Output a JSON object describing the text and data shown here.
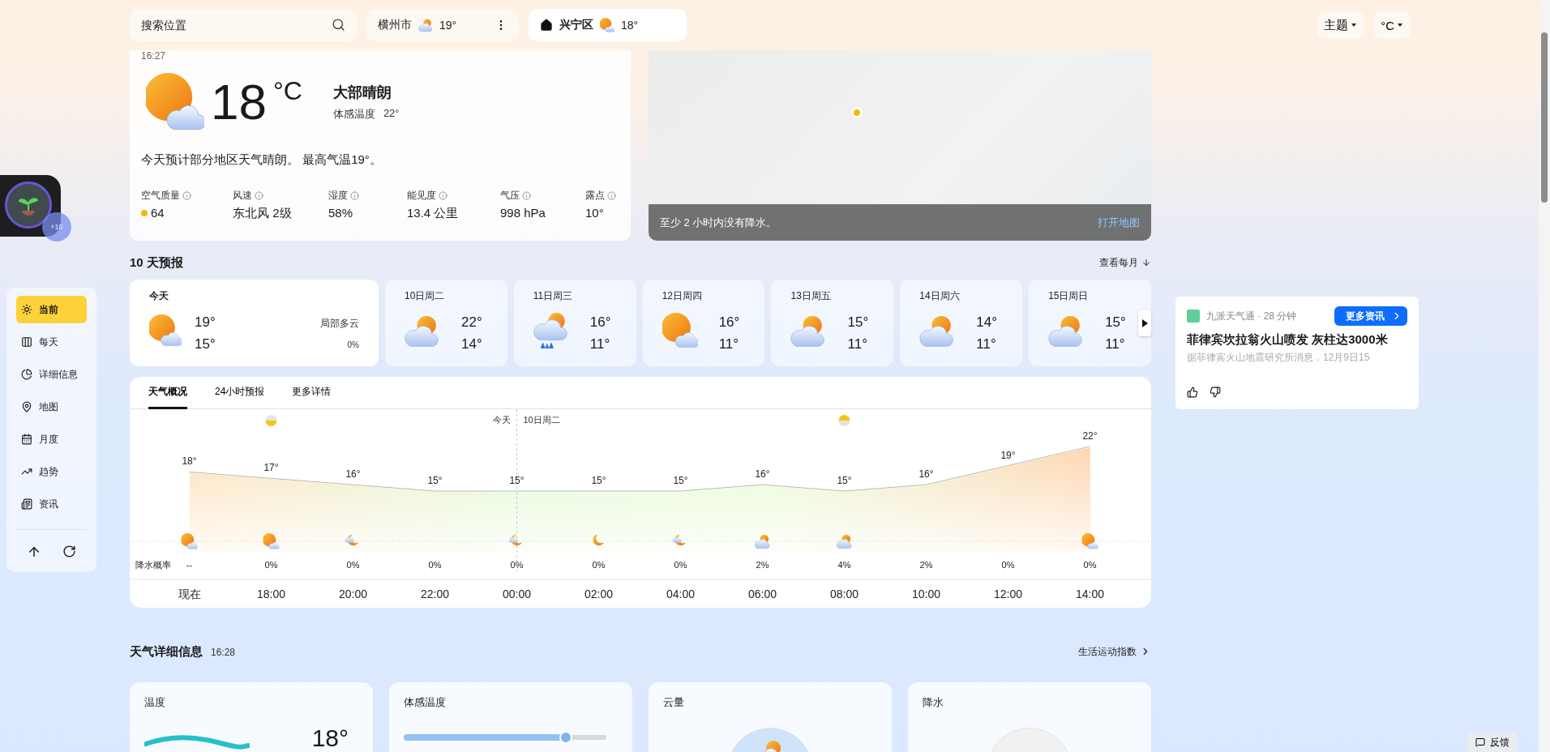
{
  "header": {
    "search": {
      "placeholder": "搜索位置"
    },
    "locations": [
      {
        "name": "横州市",
        "kind": "cloud-sun",
        "temp": "19°",
        "selected": false
      },
      {
        "name": "兴宁区",
        "kind": "sun-cloud",
        "temp": "18°",
        "selected": true
      }
    ],
    "menus": [
      "主题",
      "°C"
    ]
  },
  "widget": {
    "badge": "+10"
  },
  "sidebar": {
    "items": [
      {
        "label": "当前",
        "selected": true
      },
      {
        "label": "每天",
        "selected": false
      },
      {
        "label": "详细信息",
        "selected": false
      },
      {
        "label": "地图",
        "selected": false
      },
      {
        "label": "月度",
        "selected": false
      },
      {
        "label": "趋势",
        "selected": false
      },
      {
        "label": "资讯",
        "selected": false
      }
    ]
  },
  "current": {
    "time": "16:27",
    "temp": "18",
    "unit": "°C",
    "condition": "大部晴朗",
    "feels_label": "体感温度",
    "feels": "22°",
    "summary": "今天预计部分地区天气晴朗。 最高气温19°。",
    "metrics": [
      {
        "label": "空气质量",
        "value": "64",
        "color": "#f5b800"
      },
      {
        "label": "风速",
        "value": "东北风 2级"
      },
      {
        "label": "湿度",
        "value": "58%"
      },
      {
        "label": "能见度",
        "value": "13.4 公里"
      },
      {
        "label": "气压",
        "value": "998 hPa"
      },
      {
        "label": "露点",
        "value": "10°"
      }
    ]
  },
  "map": {
    "caption": "至少 2 小时内没有降水。",
    "link": "打开地图"
  },
  "forecast": {
    "title": "10 天预报",
    "link": "查看每月",
    "days": [
      {
        "date": "今天",
        "kind": "sun-cloud",
        "high": "19°",
        "low": "15°",
        "condition": "局部多云",
        "precip": "0%",
        "selected": true
      },
      {
        "date": "10日周二",
        "kind": "cloud-sun",
        "high": "22°",
        "low": "14°",
        "selected": false
      },
      {
        "date": "11日周三",
        "kind": "rain",
        "high": "16°",
        "low": "11°",
        "selected": false
      },
      {
        "date": "12日周四",
        "kind": "sun-cloud",
        "high": "16°",
        "low": "11°",
        "selected": false
      },
      {
        "date": "13日周五",
        "kind": "cloud-sun",
        "high": "15°",
        "low": "11°",
        "selected": false
      },
      {
        "date": "14日周六",
        "kind": "cloud-sun",
        "high": "14°",
        "low": "11°",
        "selected": false
      },
      {
        "date": "15日周日",
        "kind": "cloud-sun",
        "high": "15°",
        "low": "11°",
        "selected": false
      }
    ]
  },
  "overview": {
    "tabs": [
      {
        "label": "天气概况",
        "selected": true
      },
      {
        "label": "24小时预报",
        "selected": false
      },
      {
        "label": "更多详情",
        "selected": false
      }
    ],
    "chart_data": {
      "type": "line",
      "categories": [
        "现在",
        "18:00",
        "20:00",
        "22:00",
        "00:00",
        "02:00",
        "04:00",
        "06:00",
        "08:00",
        "10:00",
        "12:00",
        "14:00"
      ],
      "values": [
        18,
        17,
        16,
        15,
        15,
        15,
        15,
        16,
        15,
        16,
        19,
        22
      ],
      "value_labels": [
        "18°",
        "17°",
        "16°",
        "15°",
        "15°",
        "15°",
        "15°",
        "16°",
        "15°",
        "16°",
        "19°",
        "22°"
      ]
    },
    "precip_label": "降水概率",
    "hourly": [
      {
        "kind": "sun-cloud",
        "precip": "--"
      },
      {
        "kind": "sun-cloud",
        "precip": "0%"
      },
      {
        "kind": "moon-cloud",
        "precip": "0%"
      },
      {
        "precip": "0%"
      },
      {
        "kind": "moon-cloud",
        "precip": "0%",
        "day_before": "今天",
        "day_after": "10日周二"
      },
      {
        "kind": "moon",
        "precip": "0%"
      },
      {
        "kind": "moon-cloud",
        "precip": "0%"
      },
      {
        "kind": "cloud-sun",
        "precip": "2%"
      },
      {
        "kind": "cloud-sun",
        "precip": "4%"
      },
      {
        "precip": "2%"
      },
      {
        "precip": "0%"
      },
      {
        "kind": "sun-cloud",
        "precip": "0%"
      }
    ]
  },
  "details": {
    "title": "天气详细信息",
    "time": "16:28",
    "link": "生活运动指数",
    "cards": [
      {
        "kind": "temperature",
        "title": "温度",
        "value": "18°"
      },
      {
        "kind": "feels",
        "title": "体感温度",
        "level": 0.8
      },
      {
        "kind": "clouds",
        "title": "云量"
      },
      {
        "kind": "precipitation",
        "title": "降水"
      }
    ]
  },
  "news": {
    "source": "九派天气通 · 28 分钟",
    "more": "更多资讯",
    "headline": "菲律宾坎拉翁火山喷发 灰柱达3000米",
    "summary": "据菲律宾火山地震研究所消息，12月9日15"
  },
  "feedback": "反馈"
}
